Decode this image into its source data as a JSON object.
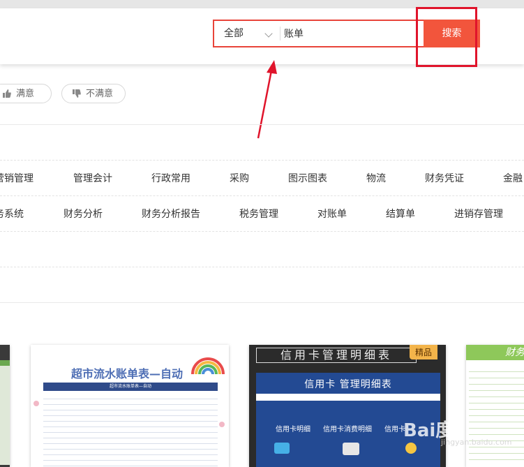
{
  "search": {
    "scope": "全部",
    "query": "账单",
    "button": "搜索"
  },
  "feedback": {
    "satisfied": "满意",
    "unsatisfied": "不满意"
  },
  "categories": {
    "row1": [
      "营销管理",
      "管理会计",
      "行政常用",
      "采购",
      "图示图表",
      "物流",
      "财务凭证",
      "金融"
    ],
    "row2": [
      "务系统",
      "财务分析",
      "财务分析报告",
      "税务管理",
      "对账单",
      "结算单",
      "进销存管理"
    ]
  },
  "templates": {
    "card1": {
      "title": "超市流水账单表—自动",
      "subtitle": "超市流水账单表—自动"
    },
    "card2": {
      "title": "信用卡管理明细表",
      "badge": "精品",
      "panel_title": "信用卡 管理明细表",
      "items": [
        "信用卡明细",
        "信用卡消费明细",
        "信用卡"
      ]
    },
    "card3": {
      "title": "财务"
    }
  },
  "watermark": {
    "logo": "Bai度",
    "site": "jingyan.baidu.com"
  },
  "colors": {
    "accent": "#f2553c",
    "annotation": "#e0142b"
  }
}
